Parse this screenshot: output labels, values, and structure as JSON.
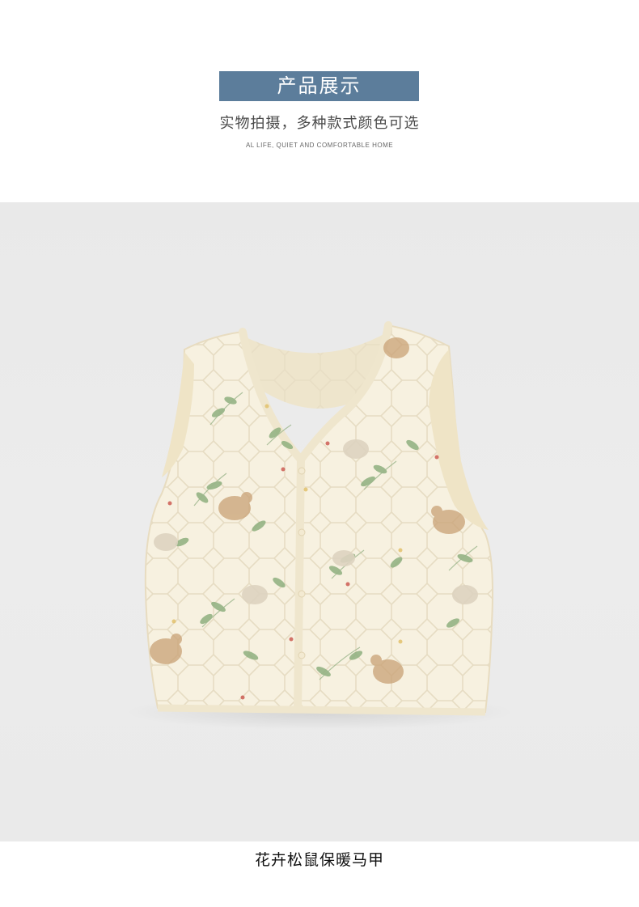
{
  "header": {
    "title": "产品展示",
    "subtitle": "实物拍摄，多种款式颜色可选",
    "tagline": "AL LIFE, QUIET AND COMFORTABLE HOME"
  },
  "product": {
    "image_icon": "floral-squirrel-vest-image",
    "caption": "花卉松鼠保暖马甲"
  },
  "colors": {
    "title_bg": "#5c7d9b",
    "photo_bg": "#eaeaea",
    "vest_fabric": "#f7f1e0",
    "vest_trim": "#efe6cd",
    "leaf_green": "#8fb07f",
    "squirrel_tan": "#c9a276"
  }
}
